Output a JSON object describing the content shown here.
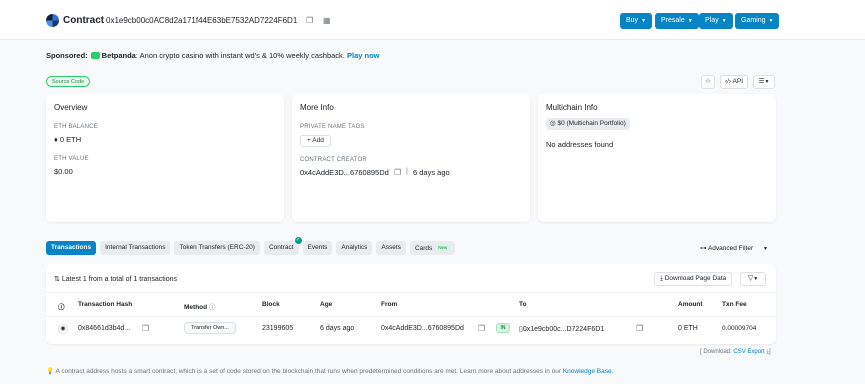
{
  "header": {
    "title": "Contract",
    "address": "0x1e9cb00c0AC8d2a171f44E63bE7532AD7224F6D1",
    "buttons": [
      "Buy",
      "Presale",
      "Play",
      "Gaming"
    ]
  },
  "sponsor": {
    "label": "Sponsored:",
    "brand": "Betpanda",
    "text": ": Anon crypto casino with instant wd's & 10% weekly cashback.",
    "cta": "Play now"
  },
  "source_badge": "Source Code",
  "api_label": "API",
  "overview": {
    "title": "Overview",
    "eth_balance_label": "ETH BALANCE",
    "eth_balance": "0 ETH",
    "eth_value_label": "ETH VALUE",
    "eth_value": "$0.00"
  },
  "more_info": {
    "title": "More Info",
    "private_tags_label": "PRIVATE NAME TAGS",
    "add_label": "+ Add",
    "creator_label": "CONTRACT CREATOR",
    "creator_address": "0x4cAddE3D...6760895Dd",
    "creator_age": "6 days ago"
  },
  "multichain": {
    "title": "Multichain Info",
    "portfolio": "$0 (Multichain Portfolio)",
    "none_text": "No addresses found"
  },
  "tabs": [
    {
      "label": "Transactions",
      "active": true
    },
    {
      "label": "Internal Transactions"
    },
    {
      "label": "Token Transfers (ERC-20)"
    },
    {
      "label": "Contract"
    },
    {
      "label": "Events"
    },
    {
      "label": "Analytics"
    },
    {
      "label": "Assets"
    },
    {
      "label": "Cards",
      "badge": "New"
    }
  ],
  "advanced_filter": "Advanced Filter",
  "table": {
    "summary": "Latest 1 from a total of 1 transactions",
    "download_label": "Download Page Data",
    "columns": [
      "Transaction Hash",
      "Method",
      "Block",
      "Age",
      "From",
      "To",
      "Amount",
      "Txn Fee"
    ],
    "rows": [
      {
        "hash": "0x84661d3b4d...",
        "method": "Transfer Own...",
        "block": "23199605",
        "age": "6 days ago",
        "from": "0x4cAddE3D...6760895Dd",
        "direction": "IN",
        "to": "0x1e9cb00c...D7224F6D1",
        "amount": "0 ETH",
        "fee": "0.00009704"
      }
    ]
  },
  "csv": {
    "prefix": "[ Download:",
    "link": "CSV Export"
  },
  "footer": {
    "text": "A contract address hosts a smart contract, which is a set of code stored on the blockchain that runs when predetermined conditions are met. Learn more about addresses in our",
    "link": "Knowledge Base."
  }
}
